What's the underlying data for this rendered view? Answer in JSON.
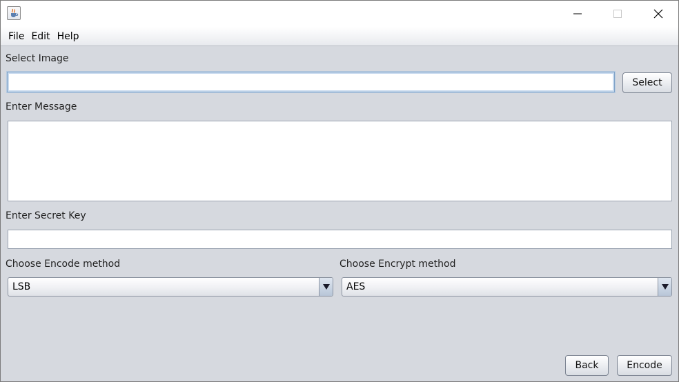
{
  "window": {
    "title": ""
  },
  "menu": {
    "items": [
      {
        "label": "File"
      },
      {
        "label": "Edit"
      },
      {
        "label": "Help"
      }
    ]
  },
  "form": {
    "select_image_label": "Select Image",
    "image_path_value": "",
    "select_button_label": "Select",
    "message_label": "Enter Message",
    "message_value": "",
    "secret_key_label": "Enter Secret Key",
    "secret_key_value": "",
    "encode_method_label": "Choose Encode method",
    "encode_method_value": "LSB",
    "encrypt_method_label": "Choose Encrypt method",
    "encrypt_method_value": "AES"
  },
  "footer": {
    "back_label": "Back",
    "encode_label": "Encode"
  }
}
